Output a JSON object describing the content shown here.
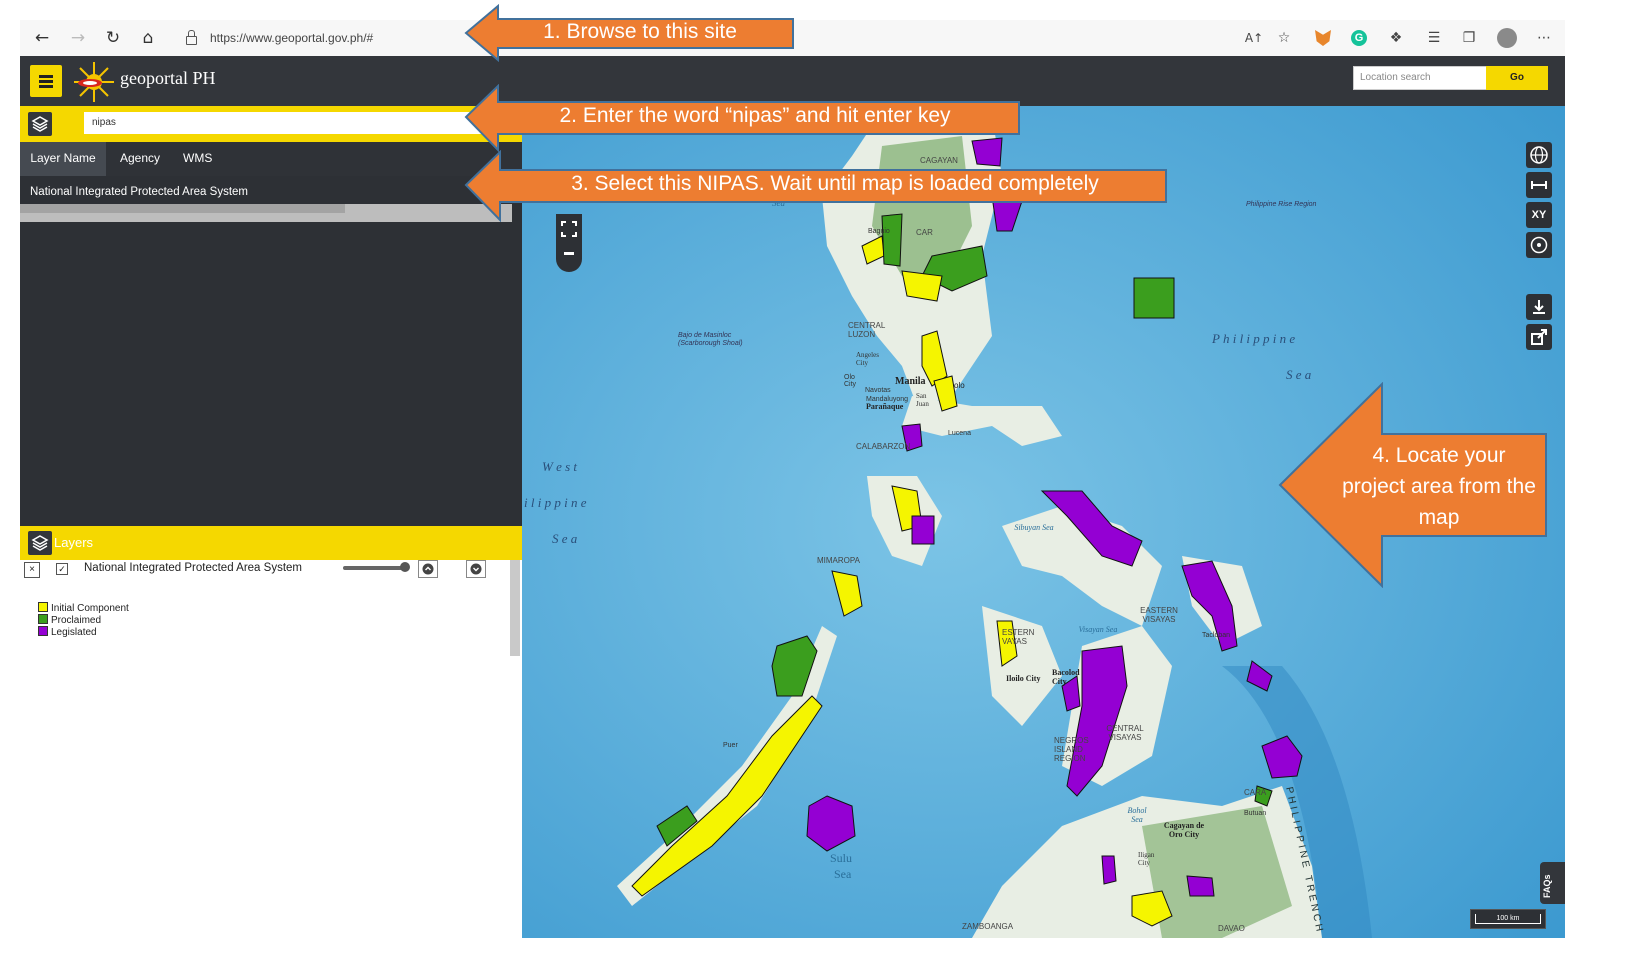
{
  "browser": {
    "url": "https://www.geoportal.gov.ph/#",
    "read_aloud_icon": "A↑"
  },
  "header": {
    "brand": "geoportal PH",
    "location_search_placeholder": "Location search",
    "go_label": "Go"
  },
  "search": {
    "value": "nipas",
    "tabs": [
      "Layer Name",
      "Agency",
      "WMS"
    ],
    "result": "National Integrated Protected Area System"
  },
  "layers": {
    "title": "Layers",
    "remove_symbol": "×",
    "check_symbol": "✓",
    "layer_name": "National Integrated Protected Area System",
    "opacity": 1.0,
    "legend": [
      {
        "label": "Initial Component",
        "color": "#f5f500"
      },
      {
        "label": "Proclaimed",
        "color": "#3b9e1e"
      },
      {
        "label": "Legislated",
        "color": "#9400d3"
      }
    ]
  },
  "map": {
    "controls_right": [
      "globe-icon",
      "measure-icon",
      "XY",
      "locate-icon"
    ],
    "controls_right2": [
      "download-icon",
      "share-icon"
    ],
    "xy_label": "XY",
    "scale": "100 km",
    "faqs": "FAQs",
    "labels": {
      "philippine_rise": "Philippine Rise Region",
      "philippine_sea": "P h i l i p p i n e",
      "philippine_sea2": "S e a",
      "scarborough": "Bajo de Masinloc\n(Scarborough Shoal)",
      "west": "W e s t",
      "west2": "i l i p p i n e",
      "west3": "S e a",
      "sulu": "Sulu",
      "sulu2": "Sea",
      "trench": "PHILIPPINE TRENCH",
      "manila": "Manila",
      "central_luzon": "CENTRAL LUZON",
      "angeles": "Angeles City",
      "calabarzon": "CALABARZON",
      "mimaropa": "MIMAROPA",
      "sibuyan": "Sibuyan Sea",
      "visayan": "Visayan Sea",
      "bohol": "Bohol Sea",
      "eastern_visayas": "EASTERN VISAYAS",
      "central_visayas": "CENTRAL VISAYAS",
      "iloilo": "Iloilo City",
      "bacolod": "Bacolod City",
      "cagayan": "Cagayan de Oro City",
      "tacloban": "Tacloban",
      "zamboanga": "ZAMBOANGA",
      "davao": "DAVAO",
      "car": "CAR",
      "cagayan_n": "CAGAYAN",
      "sea_n": "Sea",
      "paranaque": "Parañaque",
      "san_juan": "San Juan",
      "iligan": "Iligan City",
      "butuan": "Butuan",
      "negros": "NEGROS ISLAND REGION",
      "caraga": "CARA",
      "western_visayas": "ESTERN VAYAS",
      "navotas": "Navotas",
      "mandaluyong": "Mandaluyong",
      "olongapo": "Olo City",
      "bulacan": "olo",
      "baguio": "Baguio",
      "puerto": "Puer",
      "lucena": "Lucena"
    }
  },
  "callouts": [
    "1. Browse to this site",
    "2. Enter the word “nipas” and hit enter key",
    "3. Select this NIPAS. Wait until map is loaded completely",
    "4. Locate your project area from the map"
  ],
  "colors": {
    "accent": "#f5d800",
    "callout": "#ed7d31",
    "callout_border": "#41719c",
    "dark": "#33363b"
  }
}
